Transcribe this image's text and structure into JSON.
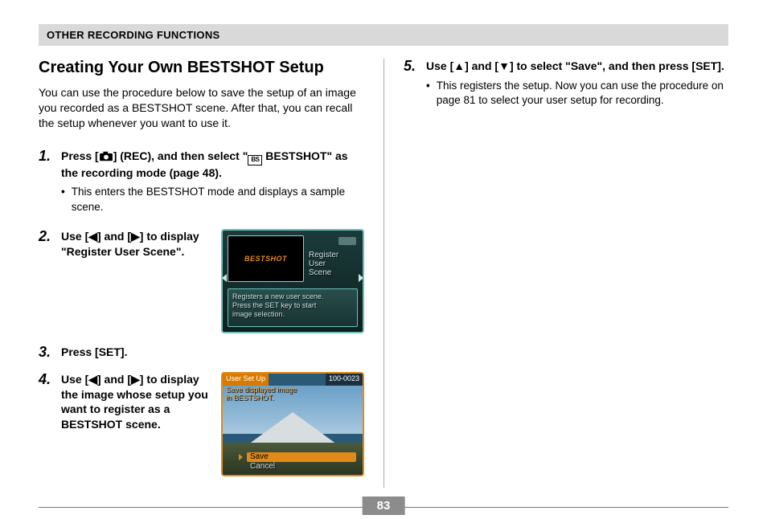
{
  "section_header": "OTHER RECORDING FUNCTIONS",
  "title": "Creating Your Own BESTSHOT Setup",
  "intro": "You can use the procedure below to save the setup of an image you recorded as a BESTSHOT scene. After that, you can recall the setup whenever you want to use it.",
  "steps": {
    "1": {
      "num": "1.",
      "text_pre": "Press [",
      "text_mid": "] (REC), and then select \"",
      "text_post": " BESTSHOT\" as the recording mode (page 48).",
      "bullet": "This enters the BESTSHOT mode and displays a sample scene."
    },
    "2": {
      "num": "2.",
      "text": "Use [◀] and [▶] to display \"Register User Scene\"."
    },
    "3": {
      "num": "3.",
      "text": "Press [SET]."
    },
    "4": {
      "num": "4.",
      "text": "Use [◀] and [▶] to display the image whose setup you want to register as a BESTSHOT scene."
    },
    "5": {
      "num": "5.",
      "text": "Use [▲] and [▼] to select \"Save\", and then press [SET].",
      "bullet": "This registers the setup. Now you can use the procedure on page 81 to select your user setup for recording."
    }
  },
  "shot1": {
    "logo": "BESTSHOT",
    "side": {
      "l1": "Register",
      "l2": "User",
      "l3": "Scene"
    },
    "desc": {
      "l1": "Registers a new user scene.",
      "l2": "Press the SET key to start",
      "l3": "image selection."
    }
  },
  "shot2": {
    "title": "User Set Up",
    "counter": "100-0023",
    "sub1": "Save displayed image",
    "sub2": "in BESTSHOT.",
    "opt_save": "Save",
    "opt_cancel": "Cancel"
  },
  "bs_icon_text": "BS",
  "page_number": "83"
}
